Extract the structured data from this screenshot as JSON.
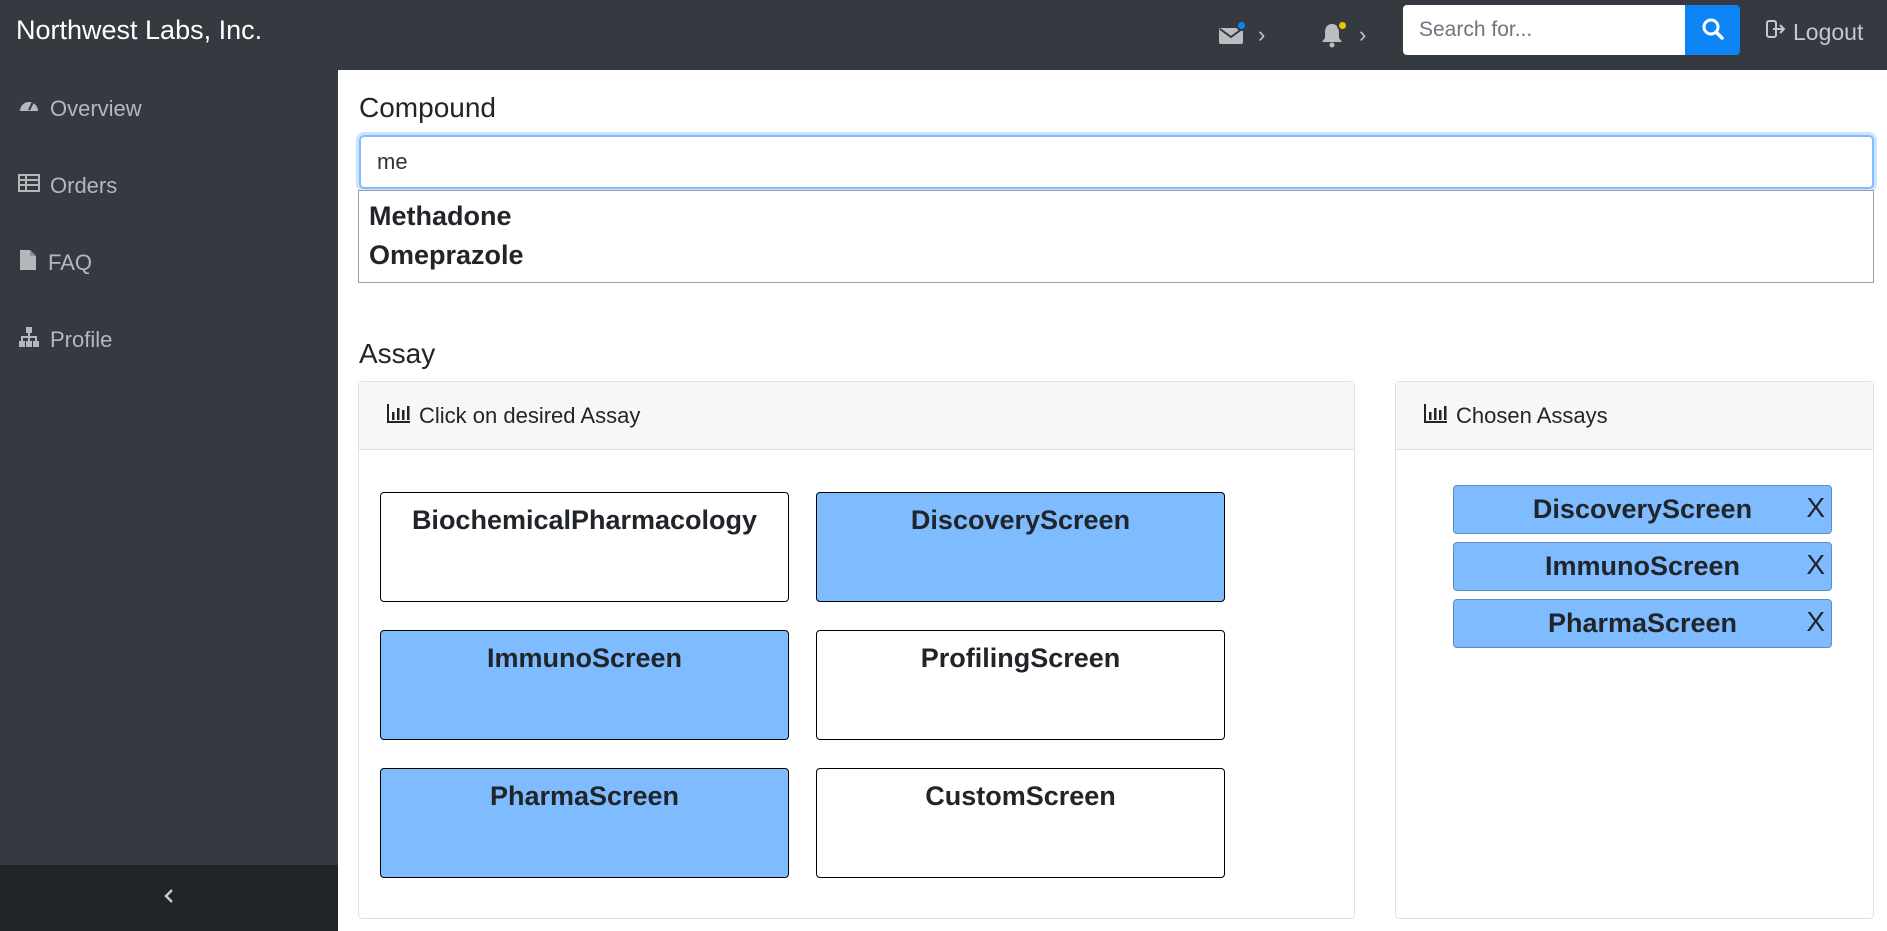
{
  "header": {
    "brand": "Northwest Labs, Inc.",
    "search_placeholder": "Search for...",
    "logout_label": "Logout",
    "message_dot_color": "#0d84f5",
    "alert_dot_color": "#f5c200"
  },
  "sidebar": {
    "items": [
      {
        "label": "Overview",
        "icon": "tachometer-icon"
      },
      {
        "label": "Orders",
        "icon": "table-icon"
      },
      {
        "label": "FAQ",
        "icon": "file-icon"
      },
      {
        "label": "Profile",
        "icon": "sitemap-icon"
      }
    ]
  },
  "compound": {
    "label": "Compound",
    "value": "me",
    "suggestions": [
      "Methadone",
      "Omeprazole"
    ]
  },
  "assay": {
    "label": "Assay",
    "picker_header": "Click on desired Assay",
    "chosen_header": "Chosen Assays",
    "options": [
      {
        "name": "BiochemicalPharmacology",
        "selected": false
      },
      {
        "name": "DiscoveryScreen",
        "selected": true
      },
      {
        "name": "ImmunoScreen",
        "selected": true
      },
      {
        "name": "ProfilingScreen",
        "selected": false
      },
      {
        "name": "PharmaScreen",
        "selected": true
      },
      {
        "name": "CustomScreen",
        "selected": false
      }
    ],
    "chosen": [
      "DiscoveryScreen",
      "ImmunoScreen",
      "PharmaScreen"
    ],
    "remove_label": "X",
    "selected_color": "#7fbcff"
  }
}
